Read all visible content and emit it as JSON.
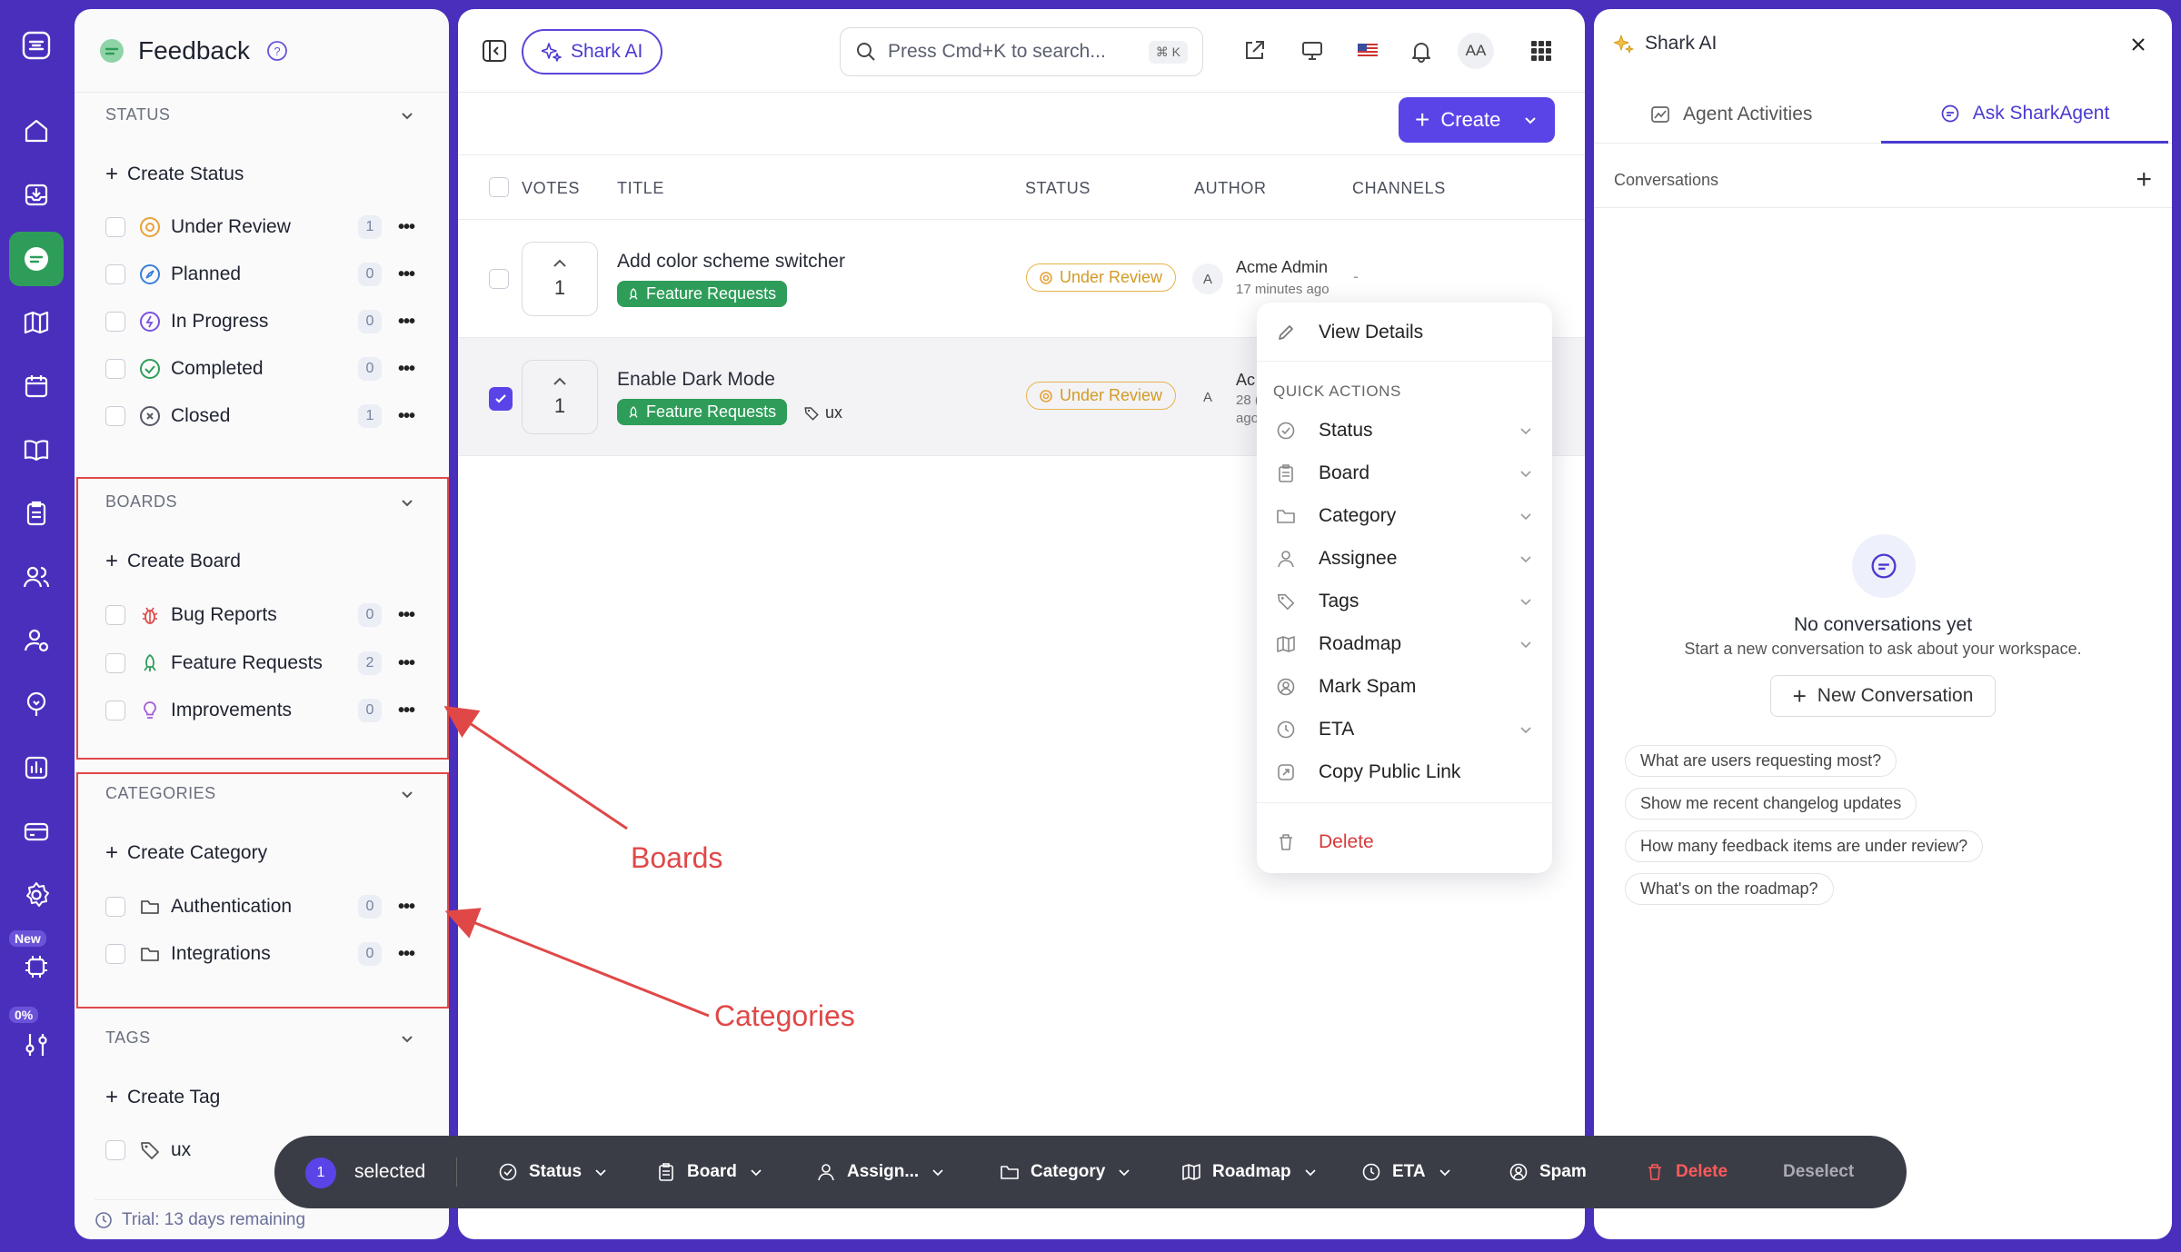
{
  "rail": {
    "new_badge": "New",
    "percent_badge": "0%"
  },
  "sidebar": {
    "title": "Feedback",
    "status": {
      "heading": "STATUS",
      "create": "Create Status",
      "items": [
        {
          "label": "Under Review",
          "count": "1",
          "color": "#e8a23a"
        },
        {
          "label": "Planned",
          "count": "0",
          "color": "#3b7fd8"
        },
        {
          "label": "In Progress",
          "count": "0",
          "color": "#7a52e0"
        },
        {
          "label": "Completed",
          "count": "0",
          "color": "#2f9d5a"
        },
        {
          "label": "Closed",
          "count": "1",
          "color": "#555a66"
        }
      ]
    },
    "boards": {
      "heading": "BOARDS",
      "create": "Create Board",
      "items": [
        {
          "label": "Bug Reports",
          "count": "0",
          "color": "#e04848"
        },
        {
          "label": "Feature Requests",
          "count": "2",
          "color": "#2f9d5a"
        },
        {
          "label": "Improvements",
          "count": "0",
          "color": "#a25ad8"
        }
      ]
    },
    "categories": {
      "heading": "CATEGORIES",
      "create": "Create Category",
      "items": [
        {
          "label": "Authentication",
          "count": "0"
        },
        {
          "label": "Integrations",
          "count": "0"
        }
      ]
    },
    "tags": {
      "heading": "TAGS",
      "create": "Create Tag",
      "items": [
        {
          "label": "ux"
        }
      ]
    },
    "trial": "Trial: 13 days remaining"
  },
  "toolbar": {
    "ai_button": "Shark AI",
    "search_placeholder": "Press Cmd+K to search...",
    "search_shortcut": "⌘ K",
    "avatar": "AA",
    "create_button": "Create"
  },
  "table": {
    "headers": {
      "votes": "VOTES",
      "title": "TITLE",
      "status": "STATUS",
      "author": "AUTHOR",
      "channels": "CHANNELS"
    },
    "rows": [
      {
        "votes": "1",
        "title": "Add color scheme switcher",
        "board": "Feature Requests",
        "status": "Under Review",
        "author_initial": "A",
        "author": "Acme Admin",
        "time": "17 minutes ago",
        "channels": "-",
        "selected": false
      },
      {
        "votes": "1",
        "title": "Enable Dark Mode",
        "board": "Feature Requests",
        "tag": "ux",
        "status": "Under Review",
        "author_initial": "A",
        "author": "Ac",
        "time": "28 (",
        "time2": "ago",
        "selected": true
      }
    ]
  },
  "context_menu": {
    "view_details": "View Details",
    "quick_actions_heading": "QUICK ACTIONS",
    "items": [
      {
        "label": "Status"
      },
      {
        "label": "Board"
      },
      {
        "label": "Category"
      },
      {
        "label": "Assignee"
      },
      {
        "label": "Tags"
      },
      {
        "label": "Roadmap"
      },
      {
        "label": "Mark Spam"
      },
      {
        "label": "ETA"
      },
      {
        "label": "Copy Public Link"
      }
    ],
    "delete": "Delete"
  },
  "bulk_bar": {
    "count": "1",
    "selected": "selected",
    "status": "Status",
    "board": "Board",
    "assign": "Assign...",
    "category": "Category",
    "roadmap": "Roadmap",
    "eta": "ETA",
    "spam": "Spam",
    "delete": "Delete",
    "deselect": "Deselect"
  },
  "ai_panel": {
    "title": "Shark AI",
    "tab_activities": "Agent Activities",
    "tab_ask": "Ask SharkAgent",
    "conversations": "Conversations",
    "empty_title": "No conversations yet",
    "empty_sub": "Start a new conversation to ask about your workspace.",
    "new_conversation": "New Conversation",
    "suggestions": [
      "What are users requesting most?",
      "Show me recent changelog updates",
      "How many feedback items are under review?",
      "What's on the roadmap?"
    ]
  },
  "annotations": {
    "boards": "Boards",
    "categories": "Categories"
  },
  "colors": {
    "accent": "#5a44e8",
    "brand_bg": "#4a2fbd",
    "green": "#2f9d5a",
    "danger": "#e04848",
    "status_review": "#e8a23a"
  }
}
